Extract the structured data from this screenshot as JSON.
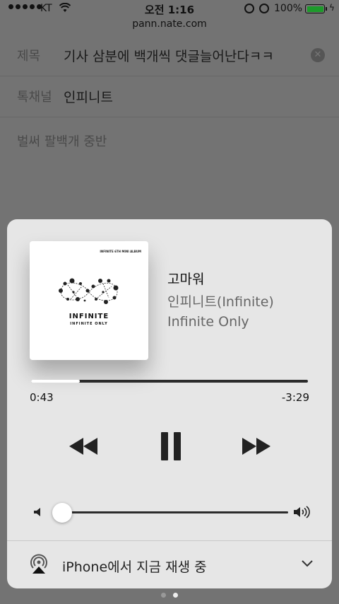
{
  "status_bar": {
    "carrier": "KT",
    "time": "오전 1:16",
    "battery_percent": "100%"
  },
  "browser": {
    "url": "pann.nate.com"
  },
  "post_form": {
    "title_label": "제목",
    "title_value": "기사 삼분에 백개씩 댓글늘어난다ㅋㅋ",
    "channel_label": "톡채널",
    "channel_value": "인피니트",
    "body_text": "벌써 팔백개 중반"
  },
  "now_playing": {
    "artwork": {
      "album_tag": "INFINITE 6TH MINI ALBUM",
      "logo_main": "INFINITE",
      "logo_sub": "INFINITE ONLY"
    },
    "song_title": "고마워",
    "artist": "인피니트(Infinite)",
    "album": "Infinite Only",
    "progress_fraction": 0.175,
    "time_elapsed": "0:43",
    "time_remaining": "-3:29",
    "volume_fraction": 0.0,
    "airplay_label": "iPhone에서 지금 재생 중"
  },
  "page_indicator": {
    "count": 2,
    "active_index": 1
  },
  "icons": [
    "signal-dots",
    "wifi-icon",
    "rotation-lock-icon",
    "alarm-icon",
    "battery-icon",
    "clear-icon",
    "rewind-icon",
    "pause-icon",
    "fast-forward-icon",
    "volume-low-icon",
    "volume-high-icon",
    "airplay-icon",
    "chevron-down-icon"
  ],
  "colors": {
    "card_background": "#e6e6e6",
    "battery_fill": "#1d9a2b",
    "scrubber_elapsed": "#ffffff",
    "scrubber_track": "#2c2c2c"
  }
}
